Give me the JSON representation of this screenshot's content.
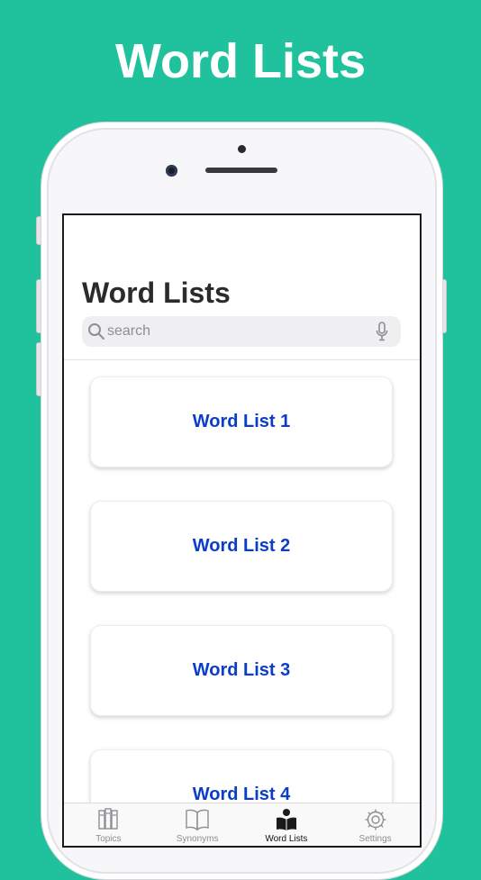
{
  "promo": {
    "title": "Word Lists"
  },
  "screen": {
    "title": "Word Lists",
    "search": {
      "placeholder": "search"
    },
    "cards": [
      {
        "label": "Word List 1"
      },
      {
        "label": "Word List 2"
      },
      {
        "label": "Word List 3"
      },
      {
        "label": "Word List 4"
      }
    ],
    "tabs": [
      {
        "label": "Topics",
        "icon": "books-icon",
        "active": false
      },
      {
        "label": "Synonyms",
        "icon": "open-book-icon",
        "active": false
      },
      {
        "label": "Word Lists",
        "icon": "reader-icon",
        "active": true
      },
      {
        "label": "Settings",
        "icon": "gear-icon",
        "active": false
      }
    ]
  },
  "colors": {
    "background": "#1fc29c",
    "accent": "#0b3ec6",
    "tab_inactive": "#8e8e93",
    "tab_active": "#111111"
  }
}
